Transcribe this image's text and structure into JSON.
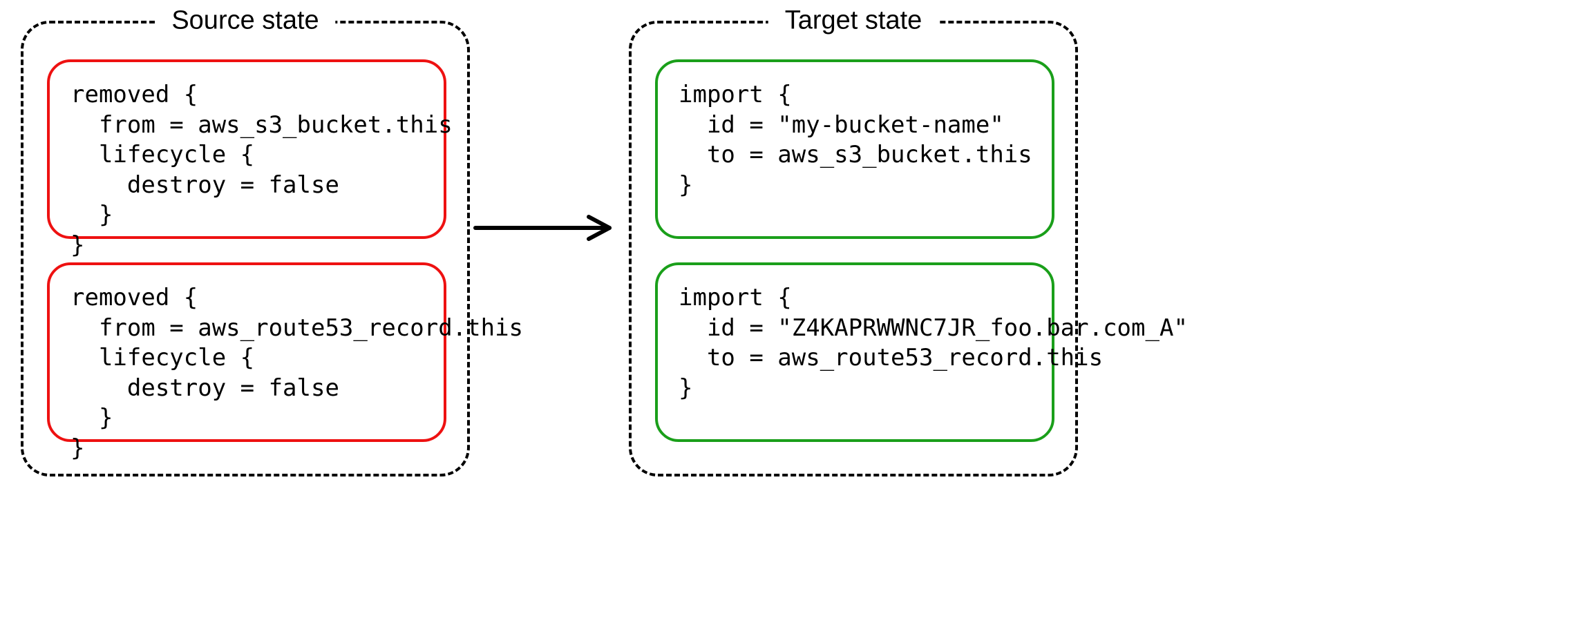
{
  "diagram": {
    "source": {
      "title": "Source state",
      "blocks": [
        {
          "code": "removed {\n  from = aws_s3_bucket.this\n  lifecycle {\n    destroy = false\n  }\n}"
        },
        {
          "code": "removed {\n  from = aws_route53_record.this\n  lifecycle {\n    destroy = false\n  }\n}"
        }
      ]
    },
    "target": {
      "title": "Target state",
      "blocks": [
        {
          "code": "import {\n  id = \"my-bucket-name\"\n  to = aws_s3_bucket.this\n}"
        },
        {
          "code": "import {\n  id = \"Z4KAPRWWNC7JR_foo.bar.com_A\"\n  to = aws_route53_record.this\n}"
        }
      ]
    },
    "colors": {
      "source_box_border": "#e11d1d",
      "target_box_border": "#1a9f1a",
      "dash_border": "#000000",
      "arrow": "#000000"
    }
  }
}
